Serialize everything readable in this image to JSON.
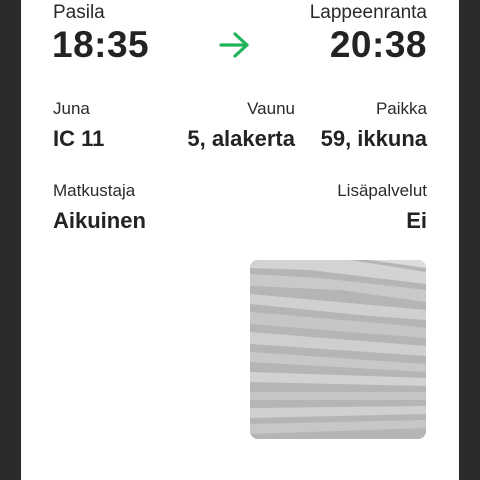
{
  "journey": {
    "from_station": "Pasila",
    "to_station": "Lappeenranta",
    "departure_time": "18:35",
    "arrival_time": "20:38",
    "arrow_icon": "arrow-right-icon",
    "arrow_color": "#1fb35a"
  },
  "details": {
    "train_label": "Juna",
    "train_value": "IC 11",
    "car_label": "Vaunu",
    "car_value": "5, alakerta",
    "seat_label": "Paikka",
    "seat_value": "59, ikkuna",
    "passenger_label": "Matkustaja",
    "passenger_value": "Aikuinen",
    "extras_label": "Lisäpalvelut",
    "extras_value": "Ei"
  },
  "ticket_code": {
    "icon": "ticket-code-image"
  }
}
